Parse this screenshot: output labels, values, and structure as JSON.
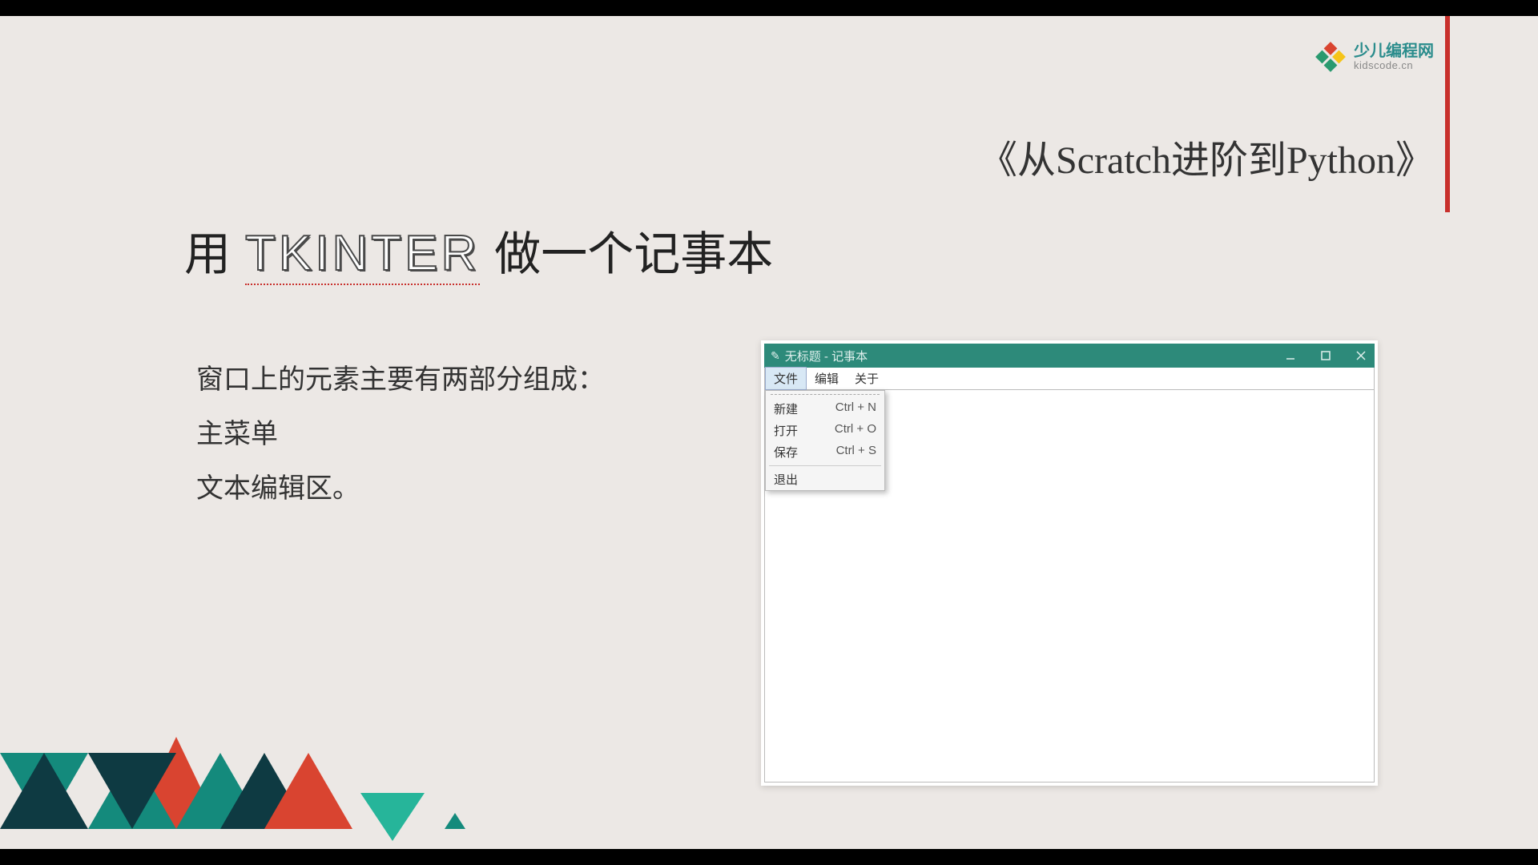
{
  "logo": {
    "main": "少儿编程网",
    "sub": "kidscode.cn"
  },
  "course_title": "《从Scratch进阶到Python》",
  "slide_title": {
    "prefix": "用",
    "tkinter": "TKINTER",
    "suffix": "做一个记事本"
  },
  "body": {
    "line1": "窗口上的元素主要有两部分组成：",
    "line2": "主菜单",
    "line3": "文本编辑区。"
  },
  "notepad": {
    "title": "无标题 - 记事本",
    "menus": [
      "文件",
      "编辑",
      "关于"
    ],
    "dropdown": [
      {
        "label": "新建",
        "shortcut": "Ctrl + N"
      },
      {
        "label": "打开",
        "shortcut": "Ctrl + O"
      },
      {
        "label": "保存",
        "shortcut": "Ctrl + S"
      }
    ],
    "dropdown_exit": "退出"
  }
}
